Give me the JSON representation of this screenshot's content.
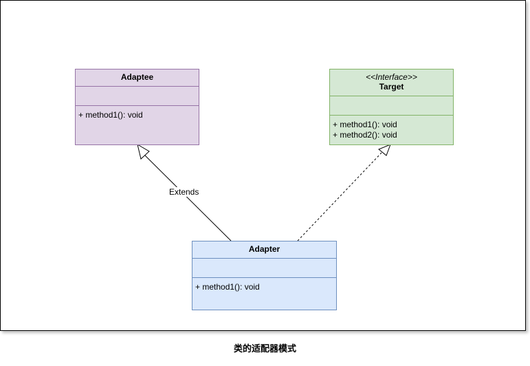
{
  "diagram": {
    "classes": {
      "adaptee": {
        "name": "Adaptee",
        "operations": [
          "+ method1(): void"
        ],
        "fill": "#e1d5e7",
        "stroke": "#9673a6"
      },
      "target": {
        "stereotype": "<<Interface>>",
        "name": "Target",
        "operations": [
          "+ method1(): void",
          "+ method2(): void"
        ],
        "fill": "#d5e8d4",
        "stroke": "#82b366"
      },
      "adapter": {
        "name": "Adapter",
        "operations": [
          "+ method1(): void"
        ],
        "fill": "#dae8fc",
        "stroke": "#6c8ebf"
      }
    },
    "edges": {
      "adapter_to_adaptee": {
        "label": "Extends",
        "kind": "generalization"
      },
      "adapter_to_target": {
        "label": "",
        "kind": "realization"
      }
    }
  },
  "caption": "类的适配器模式"
}
